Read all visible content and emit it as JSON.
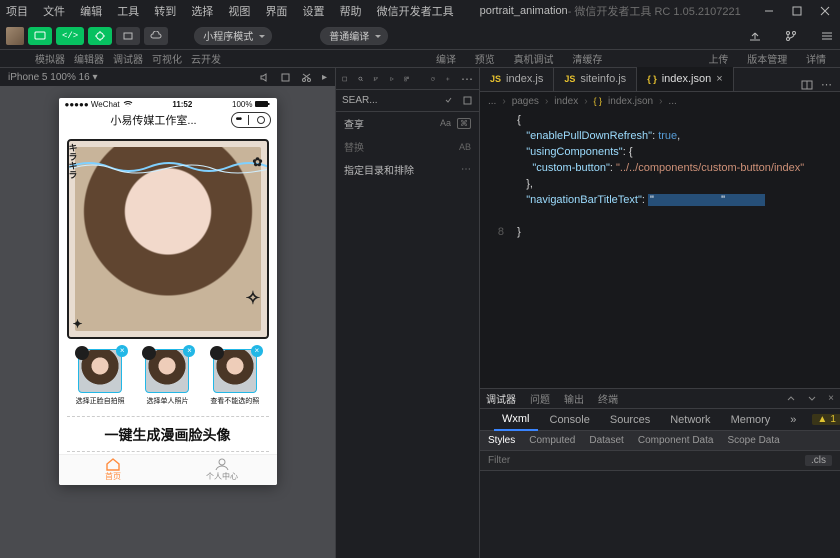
{
  "window": {
    "title_prefix": "portrait_animation",
    "title_suffix": " - 微信开发者工具 RC 1.05.2107221"
  },
  "menu": [
    "项目",
    "文件",
    "编辑",
    "工具",
    "转到",
    "选择",
    "视图",
    "界面",
    "设置",
    "帮助",
    "微信开发者工具"
  ],
  "toolbar": {
    "mode_select": "小程序模式",
    "compile_select": "普通编译",
    "btn_compile": "编译",
    "btn_preview": "预览",
    "btn_remote": "真机调试",
    "btn_clear": "清缓存",
    "btn_upload": "上传",
    "btn_version": "版本管理",
    "btn_details": "详情"
  },
  "labels": {
    "simulator": "模拟器",
    "editor": "编辑器",
    "debugger": "调试器",
    "visual": "可视化",
    "cloud": "云开发"
  },
  "sim": {
    "device": "iPhone 5 100% 16 ▾"
  },
  "phone": {
    "carrier": "●●●●● WeChat",
    "signal_icon": "wifi",
    "time": "11:52",
    "battery": "100%",
    "nav_title": "小易传媒工作室...",
    "thumbs": [
      {
        "label": "选择正脸自拍照"
      },
      {
        "label": "选择单人照片"
      },
      {
        "label": "查看不能选的照"
      }
    ],
    "slogan": "一键生成漫画脸头像",
    "tab_home": "首页",
    "tab_profile": "个人中心"
  },
  "midpanel": {
    "search": "SEAR...",
    "replace": "查享",
    "replace_hint": "替换",
    "opts_aa": "Aa",
    "opts_ab": "AB",
    "row1": "指定目录和排除"
  },
  "tabs": [
    {
      "icon": "js",
      "label": "index.js",
      "active": false
    },
    {
      "icon": "js",
      "label": "siteinfo.js",
      "active": false
    },
    {
      "icon": "json",
      "label": "index.json",
      "active": true,
      "close": true
    }
  ],
  "breadcrumbs": [
    "...",
    "pages",
    "index",
    "index.json",
    "..."
  ],
  "code": {
    "lines": [
      {
        "n": "",
        "indent": 0,
        "raw": "{",
        "twisty": "down",
        "abs_indent": 1
      },
      {
        "n": "",
        "indent": 2,
        "key": "\"enablePullDownRefresh\"",
        "sep": ": ",
        "val_bool": "true",
        "tail": ","
      },
      {
        "n": "",
        "indent": 2,
        "key": "\"usingComponents\"",
        "sep": ": ",
        "brace": "{",
        "twisty": "down"
      },
      {
        "n": "",
        "indent": 4,
        "key": "\"custom-button\"",
        "sep": ": ",
        "val_str": "\"../../components/custom-button/index\""
      },
      {
        "n": "",
        "indent": 2,
        "brace": "},"
      },
      {
        "n": "",
        "indent": 2,
        "key": "\"navigationBarTitleText\"",
        "sep": ": ",
        "val_hl": "\"                      \""
      },
      {
        "n": "",
        "indent": 0,
        "raw": ""
      },
      {
        "n": "8",
        "indent": 0,
        "brace": "}",
        "abs_indent": 1
      }
    ]
  },
  "devtools": {
    "tabrow1": {
      "debugger": "调试器",
      "problems": "问题",
      "output": "输出",
      "terminal": "终端"
    },
    "tabrow2": [
      "Wxml",
      "Console",
      "Sources",
      "Network",
      "Memory"
    ],
    "more": "»",
    "warn": "1",
    "subtabs": [
      "Styles",
      "Computed",
      "Dataset",
      "Component Data",
      "Scope Data"
    ],
    "filter_placeholder": "Filter",
    "cls": ".cls"
  }
}
